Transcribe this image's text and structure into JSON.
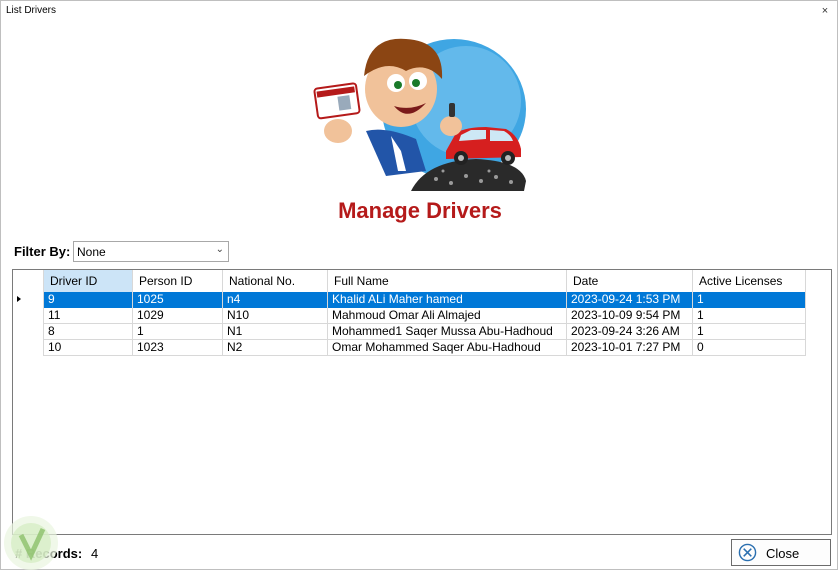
{
  "window": {
    "title": "List Drivers",
    "close_glyph": "×"
  },
  "header": {
    "title": "Manage Drivers",
    "hero_icon": "driver-with-license-and-car-illustration"
  },
  "filter": {
    "label": "Filter By:",
    "selected": "None"
  },
  "grid": {
    "columns": [
      "Driver ID",
      "Person ID",
      "National No.",
      "Full Name",
      "Date",
      "Active Licenses"
    ],
    "rows": [
      [
        "9",
        "1025",
        "n4",
        "Khalid ALi Maher hamed",
        "2023-09-24 1:53 PM",
        "1"
      ],
      [
        "11",
        "1029",
        "N10",
        "Mahmoud Omar Ali Almajed",
        "2023-10-09 9:54 PM",
        "1"
      ],
      [
        "8",
        "1",
        "N1",
        "Mohammed1 Saqer Mussa Abu-Hadhoud",
        "2023-09-24 3:26 AM",
        "1"
      ],
      [
        "10",
        "1023",
        "N2",
        "Omar Mohammed Saqer Abu-Hadhoud",
        "2023-10-01 7:27 PM",
        "0"
      ]
    ],
    "selected_row": 0
  },
  "footer": {
    "records_label": "# Records:",
    "records_count": "4",
    "close_label": "Close"
  },
  "colors": {
    "accent": "#0078d7",
    "title": "#b51a1a"
  }
}
